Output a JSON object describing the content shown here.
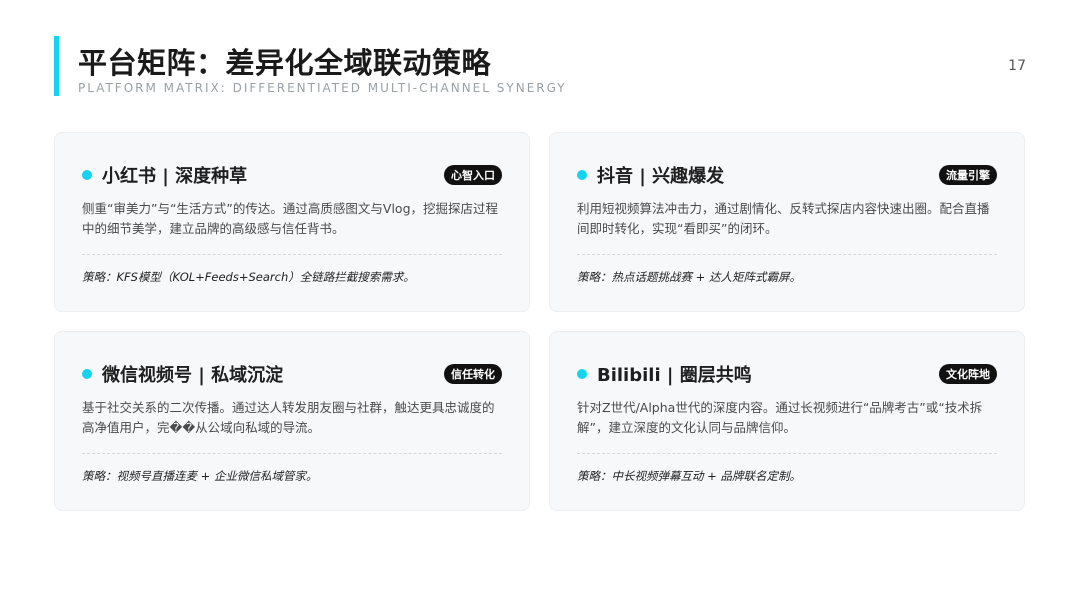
{
  "header": {
    "title": "平台矩阵：差异化全域联动策略",
    "subtitle": "PLATFORM MATRIX: DIFFERENTIATED MULTI-CHANNEL SYNERGY",
    "page_number": "17"
  },
  "colors": {
    "accent": "#12d3f2",
    "card_bg": "#f7f8fa",
    "badge_bg": "#111111"
  },
  "cards": [
    {
      "title": "小红书 | 深度种草",
      "badge": "心智入口",
      "description": "侧重“审美力”与“生活方式”的传达。通过高质感图文与Vlog，挖掘探店过程中的细节美学，建立品牌的高级感与信任背书。",
      "strategy": "策略：KFS模型（KOL+Feeds+Search）全链路拦截搜索需求。"
    },
    {
      "title": "抖音 | 兴趣爆发",
      "badge": "流量引擎",
      "description": "利用短视频算法冲击力，通过剧情化、反转式探店内容快速出圈。配合直播间即时转化，实现“看即买”的闭环。",
      "strategy": "策略：热点话题挑战赛 + 达人矩阵式霸屏。"
    },
    {
      "title": "微信视频号 | 私域沉淀",
      "badge": "信任转化",
      "description": "基于社交关系的二次传播。通过达人转发朋友圈与社群，触达更具忠诚度的高净值用户，完��从公域向私域的导流。",
      "strategy": "策略：视频号直播连麦 + 企业微信私域管家。"
    },
    {
      "title": "Bilibili | 圈层共鸣",
      "badge": "文化阵地",
      "description": "针对Z世代/Alpha世代的深度内容。通过长视频进行“品牌考古”或“技术拆解”，建立深度的文化认同与品牌信仰。",
      "strategy": "策略：中长视频弹幕互动 + 品牌联名定制。"
    }
  ]
}
